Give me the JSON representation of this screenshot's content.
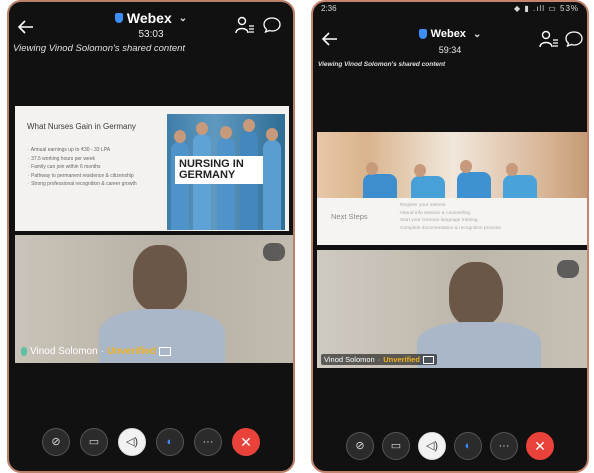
{
  "left": {
    "app_title": "Webex",
    "timer": "53:03",
    "viewing": "Viewing Vinod Solomon's shared content",
    "slide_title": "What Nurses Gain in Germany",
    "bullets": [
      "Annual earnings up to ₹30 - 33 LPA",
      "37.5 working hours per week",
      "Family can join within 6 months",
      "Pathway to permanent residence & citizenship",
      "Strong professional recognition & career growth"
    ],
    "badge": "NURSING IN GERMANY",
    "name": "Vinod Solomon",
    "separator": "·",
    "status": "Unverified"
  },
  "right": {
    "status_time": "2:36",
    "status_icons": "◆ ▮ .ıll ▭ 53%",
    "app_title": "Webex",
    "timer": "59:34",
    "viewing": "Viewing Vinod Solomon's shared content",
    "slide_heading": "Next Steps",
    "slide_lines": [
      "Register your interest",
      "Attend info session & counselling",
      "Start your German language training",
      "Complete documentation & recognition process"
    ],
    "name": "Vinod Solomon",
    "separator": "·",
    "status": "Unverified"
  },
  "icons": {
    "back": "back-arrow-icon",
    "participants": "participants-icon",
    "chat": "chat-icon",
    "mute": "mic-off-icon",
    "video": "video-off-icon",
    "audio": "speaker-icon",
    "share": "share-icon",
    "more": "more-icon",
    "leave": "close-icon"
  },
  "colors": {
    "unverified": "#f0b21f",
    "leave": "#e8423b",
    "shield": "#3d8ef7"
  }
}
